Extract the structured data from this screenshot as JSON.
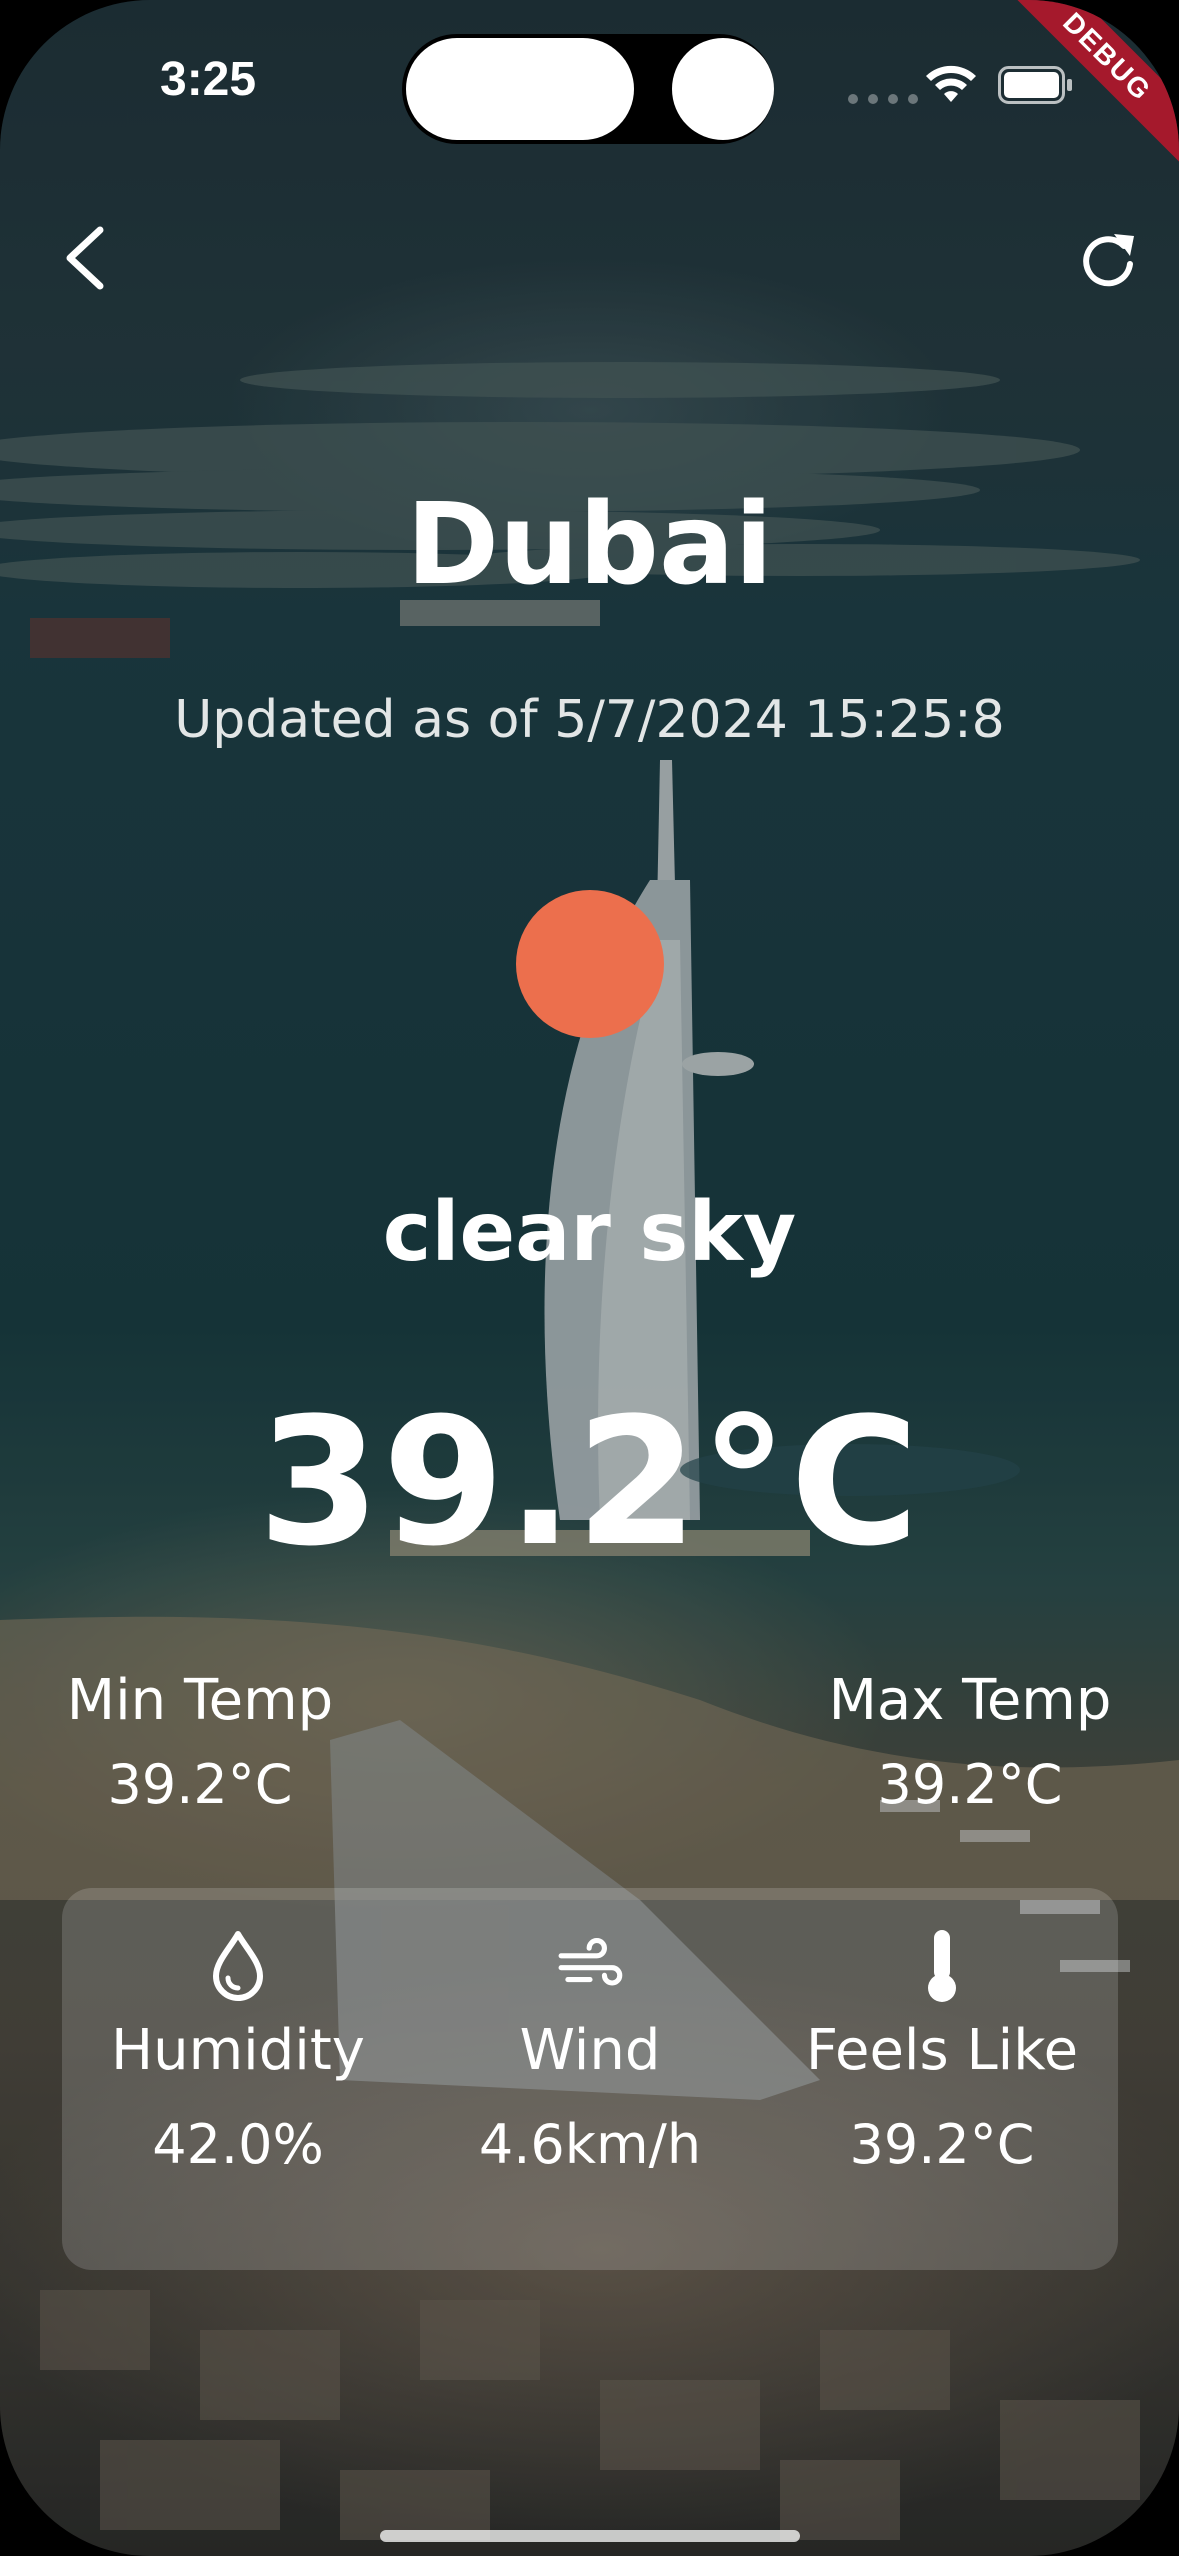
{
  "status_bar": {
    "time": "3:25",
    "debug_label": "DEBUG"
  },
  "header": {
    "back_icon": "chevron-left-icon",
    "refresh_icon": "refresh-icon"
  },
  "weather": {
    "city": "Dubai",
    "updated": "Updated as of 5/7/2024 15:25:8",
    "icon": "sun-icon",
    "icon_color": "#ec6f4d",
    "condition": "clear sky",
    "temperature": "39.2°C",
    "min_label": "Min Temp",
    "min_value": "39.2°C",
    "max_label": "Max Temp",
    "max_value": "39.2°C"
  },
  "details": [
    {
      "icon": "droplet-icon",
      "label": "Humidity",
      "value": "42.0%"
    },
    {
      "icon": "wind-icon",
      "label": "Wind",
      "value": "4.6km/h"
    },
    {
      "icon": "thermometer-icon",
      "label": "Feels Like",
      "value": "39.2°C"
    }
  ]
}
